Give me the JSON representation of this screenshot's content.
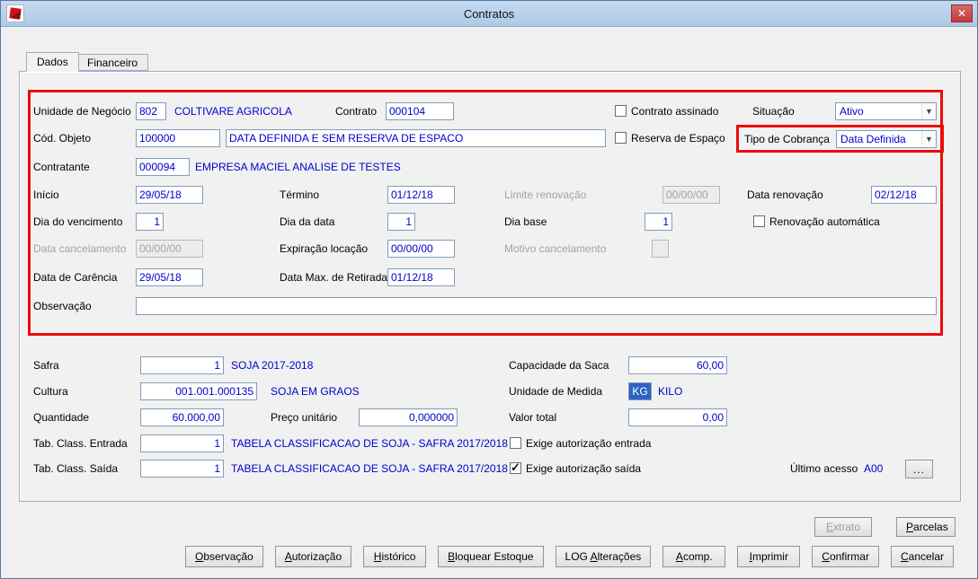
{
  "window": {
    "title": "Contratos"
  },
  "icons": {
    "close": "✕",
    "combo_arrow": "▼",
    "check": "✓"
  },
  "tabs": [
    {
      "label": "Dados"
    },
    {
      "label": "Financeiro"
    }
  ],
  "fields": {
    "unidade_negocio": {
      "label": "Unidade de Negócio",
      "value": "802",
      "desc": "COLTIVARE AGRICOLA"
    },
    "contrato": {
      "label": "Contrato",
      "value": "000104"
    },
    "contrato_assinado": {
      "label": "Contrato assinado",
      "checked": false
    },
    "situacao": {
      "label": "Situação",
      "value": "Ativo"
    },
    "cod_objeto": {
      "label": "Cód. Objeto",
      "value": "100000",
      "desc_value": "DATA DEFINIDA E SEM RESERVA DE ESPACO"
    },
    "reserva_espaco": {
      "label": "Reserva de Espaço",
      "checked": false
    },
    "tipo_cobranca": {
      "label": "Tipo de Cobrança",
      "value": "Data Definida"
    },
    "contratante": {
      "label": "Contratante",
      "value": "000094",
      "desc": "EMPRESA MACIEL ANALISE DE TESTES"
    },
    "inicio": {
      "label": "Início",
      "value": "29/05/18"
    },
    "termino": {
      "label": "Término",
      "value": "01/12/18"
    },
    "limite_renovacao": {
      "label": "Limite renovação",
      "value": "00/00/00",
      "disabled": true
    },
    "data_renovacao": {
      "label": "Data renovação",
      "value": "02/12/18"
    },
    "dia_vencimento": {
      "label": "Dia do vencimento",
      "value": "1"
    },
    "dia_data": {
      "label": "Dia da data",
      "value": "1"
    },
    "dia_base": {
      "label": "Dia base",
      "value": "1"
    },
    "renovacao_automatica": {
      "label": "Renovação automática",
      "checked": false
    },
    "data_cancelamento": {
      "label": "Data cancelamento",
      "value": "00/00/00",
      "disabled": true
    },
    "expiracao_locacao": {
      "label": "Expiração locação",
      "value": "00/00/00"
    },
    "motivo_cancelamento": {
      "label": "Motivo cancelamento",
      "value": "",
      "disabled": true
    },
    "data_carencia": {
      "label": "Data de Carência",
      "value": "29/05/18"
    },
    "data_max_retirada": {
      "label": "Data Max. de Retirada",
      "value": "01/12/18"
    },
    "observacao": {
      "label": "Observação",
      "value": ""
    },
    "safra": {
      "label": "Safra",
      "value": "1",
      "desc": "SOJA 2017-2018"
    },
    "capacidade_saca": {
      "label": "Capacidade da Saca",
      "value": "60,00"
    },
    "cultura": {
      "label": "Cultura",
      "value": "001.001.000135",
      "desc": "SOJA EM GRAOS"
    },
    "unidade_medida": {
      "label": "Unidade de Medida",
      "value": "KG",
      "desc": "KILO"
    },
    "quantidade": {
      "label": "Quantidade",
      "value": "60.000,00"
    },
    "preco_unitario": {
      "label": "Preço unitário",
      "value": "0,000000"
    },
    "valor_total": {
      "label": "Valor total",
      "value": "0,00"
    },
    "tab_class_entrada": {
      "label": "Tab. Class. Entrada",
      "value": "1",
      "desc": "TABELA CLASSIFICACAO DE SOJA - SAFRA 2017/2018"
    },
    "exige_aut_entrada": {
      "label": "Exige autorização entrada",
      "checked": false
    },
    "tab_class_saida": {
      "label": "Tab. Class. Saída",
      "value": "1",
      "desc": "TABELA CLASSIFICACAO DE SOJA - SAFRA 2017/2018"
    },
    "exige_aut_saida": {
      "label": "Exige autorização saída",
      "checked": true
    },
    "ultimo_acesso": {
      "label": "Último acesso",
      "value": "A00"
    },
    "browse_button": {
      "label": "..."
    }
  },
  "footer": {
    "top": [
      {
        "label": "Extrato",
        "disabled": true
      },
      {
        "label": "Parcelas",
        "disabled": false
      }
    ],
    "bottom": [
      {
        "label": "Observação"
      },
      {
        "label": "Autorização"
      },
      {
        "label": "Histórico"
      },
      {
        "label": "Bloquear Estoque"
      },
      {
        "label": "LOG Alterações"
      },
      {
        "label": "Acomp."
      },
      {
        "label": "Imprimir"
      },
      {
        "label": "Confirmar"
      },
      {
        "label": "Cancelar"
      }
    ]
  }
}
